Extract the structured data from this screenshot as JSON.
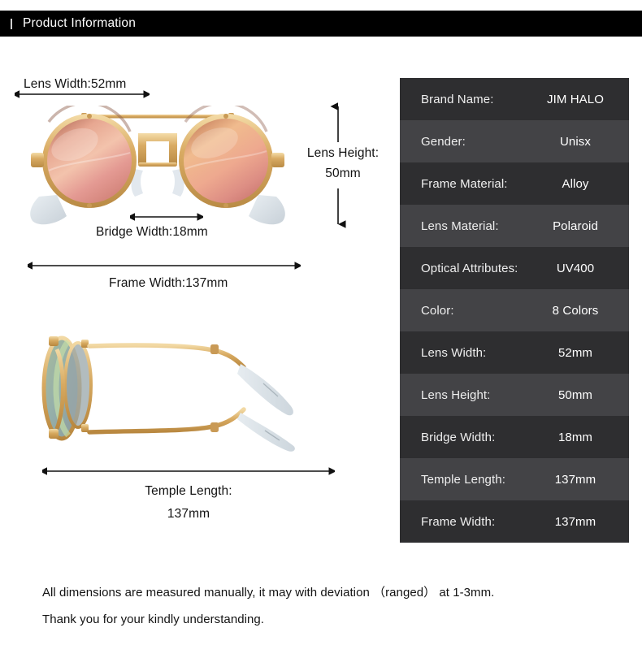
{
  "header": {
    "title": "Product Information"
  },
  "diagram": {
    "front_view": {
      "lens_width_label": "Lens Width:52mm",
      "lens_height_label_line1": "Lens Height:",
      "lens_height_label_line2": "50mm",
      "bridge_width_label": "Bridge Width:18mm",
      "frame_width_label": "Frame Width:137mm"
    },
    "side_view": {
      "temple_length_label_line1": "Temple Length:",
      "temple_length_label_line2": "137mm"
    }
  },
  "spec_table": {
    "rows": [
      {
        "label": "Brand Name:",
        "value": "JIM HALO"
      },
      {
        "label": "Gender:",
        "value": "Unisx"
      },
      {
        "label": "Frame Material:",
        "value": "Alloy"
      },
      {
        "label": "Lens Material:",
        "value": "Polaroid"
      },
      {
        "label": "Optical Attributes:",
        "value": "UV400"
      },
      {
        "label": "Color:",
        "value": "8 Colors"
      },
      {
        "label": "Lens Width:",
        "value": "52mm"
      },
      {
        "label": "Lens Height:",
        "value": "50mm"
      },
      {
        "label": "Bridge Width:",
        "value": "18mm"
      },
      {
        "label": "Temple Length:",
        "value": "137mm"
      },
      {
        "label": "Frame Width:",
        "value": "137mm"
      }
    ]
  },
  "footer": {
    "line1": "All dimensions are measured manually, it may with deviation （ranged） at 1-3mm.",
    "line2": "Thank you for your kindly understanding."
  },
  "colors": {
    "header_bg": "#000000",
    "row_dark": "#2e2e30",
    "row_light": "#434346",
    "text_light": "#ffffff",
    "text_dark": "#131313",
    "frame_gold": "#d9ab63",
    "lens_pink": "#e6a08f",
    "lens_green": "#8fae7a"
  }
}
